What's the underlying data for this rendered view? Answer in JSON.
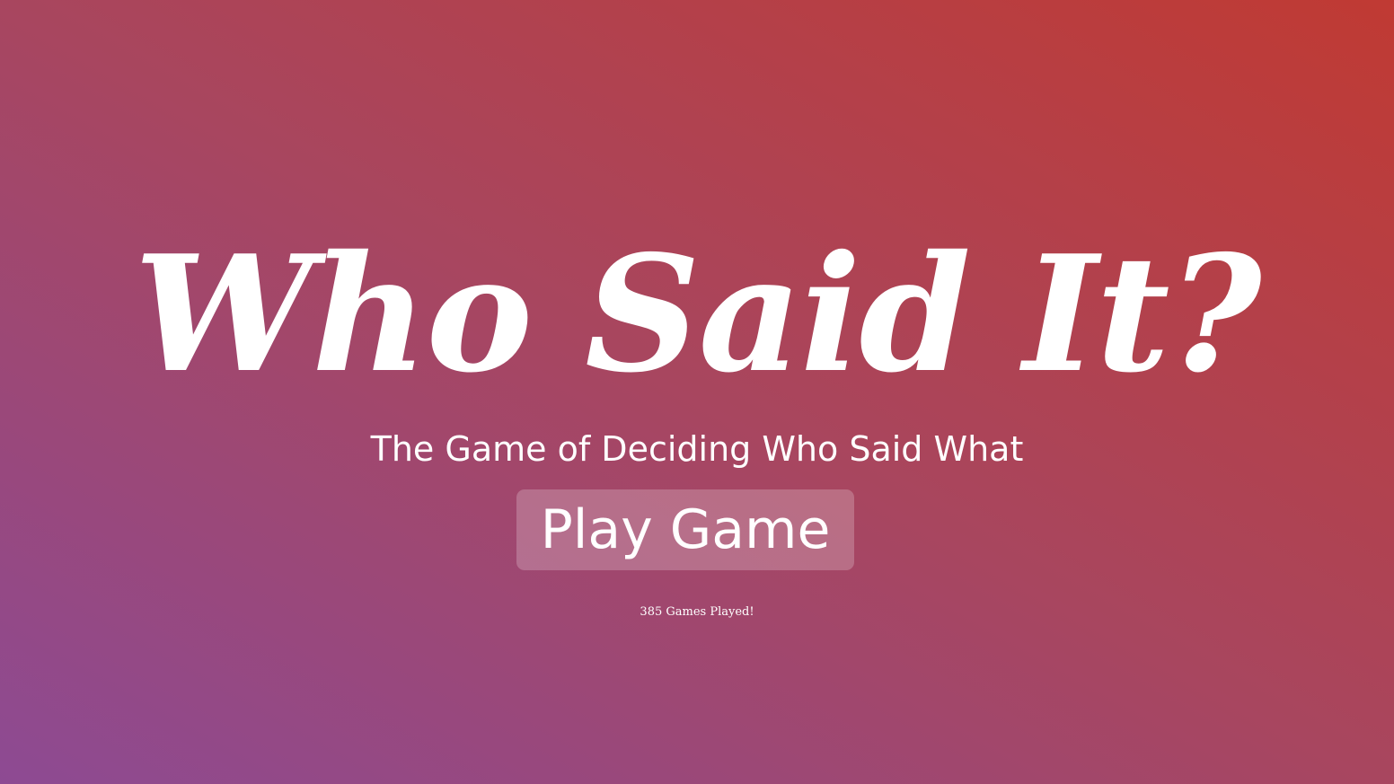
{
  "hero": {
    "title": "Who Said It?",
    "subtitle": "The Game of Deciding Who Said What",
    "play_button_label": "Play Game",
    "games_played": "385 Games Played!"
  },
  "colors": {
    "gradient_bottom_left": "#8d4a93",
    "gradient_middle": "#a8465f",
    "gradient_top_right": "#c03a33",
    "text": "#ffffff"
  }
}
